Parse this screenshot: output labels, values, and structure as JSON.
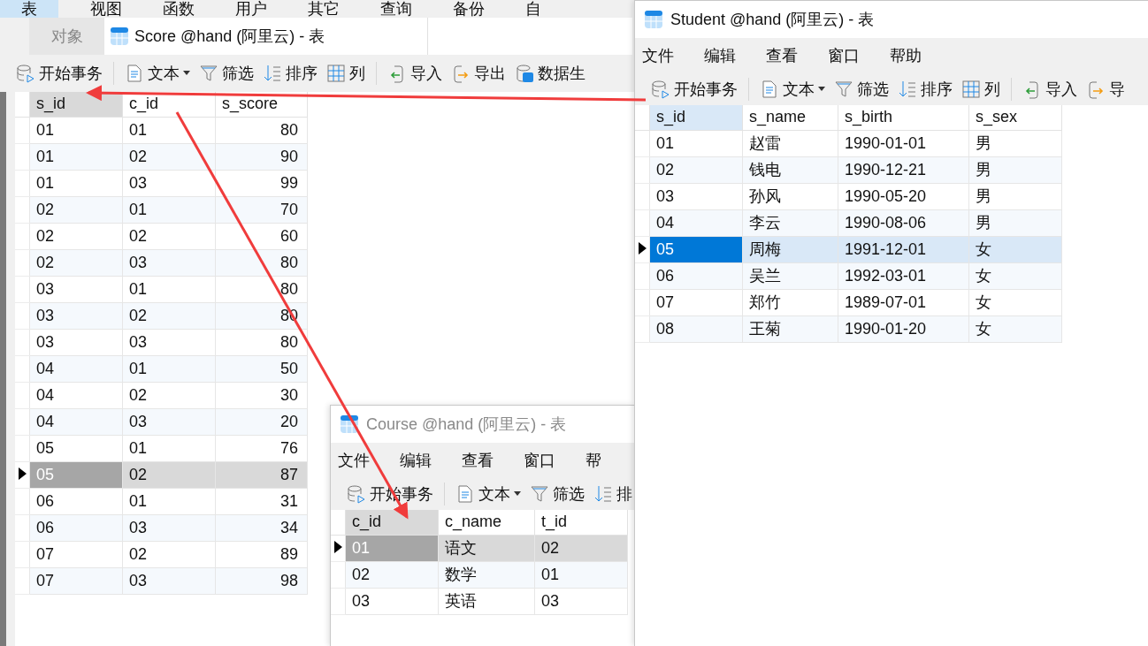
{
  "main_window": {
    "active": false,
    "menu": [
      {
        "label": "表",
        "selected": true
      },
      {
        "label": "视图",
        "selected": false
      },
      {
        "label": "函数",
        "selected": false
      },
      {
        "label": "用户",
        "selected": false
      },
      {
        "label": "其它",
        "selected": false
      },
      {
        "label": "查询",
        "selected": false
      },
      {
        "label": "备份",
        "selected": false
      },
      {
        "label": "自",
        "selected": false
      }
    ],
    "tabs": [
      {
        "label": "对象",
        "selected": false
      },
      {
        "label": "Score @hand (阿里云) - 表",
        "selected": true
      }
    ],
    "toolbar": [
      [
        {
          "kind": "transaction",
          "label": "开始事务"
        }
      ],
      [
        {
          "kind": "text",
          "label": "文本"
        },
        {
          "kind": "filter",
          "label": "筛选"
        },
        {
          "kind": "sort",
          "label": "排序"
        },
        {
          "kind": "columns",
          "label": "列"
        }
      ],
      [
        {
          "kind": "import",
          "label": "导入"
        },
        {
          "kind": "export",
          "label": "导出"
        },
        {
          "kind": "generate",
          "label": "数据生"
        }
      ]
    ],
    "table": {
      "columns": [
        {
          "label": "s_id",
          "selected": true,
          "kind": "text"
        },
        {
          "label": "c_id",
          "selected": false,
          "kind": "text"
        },
        {
          "label": "s_score",
          "selected": false,
          "kind": "number"
        }
      ],
      "rows": [
        {
          "cells": [
            "01",
            "01",
            "80"
          ],
          "selected": false
        },
        {
          "cells": [
            "01",
            "02",
            "90"
          ],
          "selected": false
        },
        {
          "cells": [
            "01",
            "03",
            "99"
          ],
          "selected": false
        },
        {
          "cells": [
            "02",
            "01",
            "70"
          ],
          "selected": false
        },
        {
          "cells": [
            "02",
            "02",
            "60"
          ],
          "selected": false
        },
        {
          "cells": [
            "02",
            "03",
            "80"
          ],
          "selected": false
        },
        {
          "cells": [
            "03",
            "01",
            "80"
          ],
          "selected": false
        },
        {
          "cells": [
            "03",
            "02",
            "80"
          ],
          "selected": false
        },
        {
          "cells": [
            "03",
            "03",
            "80"
          ],
          "selected": false
        },
        {
          "cells": [
            "04",
            "01",
            "50"
          ],
          "selected": false
        },
        {
          "cells": [
            "04",
            "02",
            "30"
          ],
          "selected": false
        },
        {
          "cells": [
            "04",
            "03",
            "20"
          ],
          "selected": false
        },
        {
          "cells": [
            "05",
            "01",
            "76"
          ],
          "selected": false
        },
        {
          "cells": [
            "05",
            "02",
            "87"
          ],
          "selected": true
        },
        {
          "cells": [
            "06",
            "01",
            "31"
          ],
          "selected": false
        },
        {
          "cells": [
            "06",
            "03",
            "34"
          ],
          "selected": false
        },
        {
          "cells": [
            "07",
            "02",
            "89"
          ],
          "selected": false
        },
        {
          "cells": [
            "07",
            "03",
            "98"
          ],
          "selected": false
        }
      ]
    }
  },
  "student_window": {
    "title": "Student @hand (阿里云) - 表",
    "active": true,
    "menu": [
      "文件",
      "编辑",
      "查看",
      "窗口",
      "帮助"
    ],
    "toolbar": [
      [
        {
          "kind": "transaction",
          "label": "开始事务"
        }
      ],
      [
        {
          "kind": "text",
          "label": "文本"
        },
        {
          "kind": "filter",
          "label": "筛选"
        },
        {
          "kind": "sort",
          "label": "排序"
        },
        {
          "kind": "columns",
          "label": "列"
        }
      ],
      [
        {
          "kind": "import",
          "label": "导入"
        },
        {
          "kind": "export",
          "label": "导"
        }
      ]
    ],
    "table": {
      "columns": [
        {
          "label": "s_id",
          "selected": true,
          "kind": "text"
        },
        {
          "label": "s_name",
          "selected": false,
          "kind": "text"
        },
        {
          "label": "s_birth",
          "selected": false,
          "kind": "text"
        },
        {
          "label": "s_sex",
          "selected": false,
          "kind": "text"
        }
      ],
      "rows": [
        {
          "cells": [
            "01",
            "赵雷",
            "1990-01-01",
            "男"
          ],
          "selected": false
        },
        {
          "cells": [
            "02",
            "钱电",
            "1990-12-21",
            "男"
          ],
          "selected": false
        },
        {
          "cells": [
            "03",
            "孙风",
            "1990-05-20",
            "男"
          ],
          "selected": false
        },
        {
          "cells": [
            "04",
            "李云",
            "1990-08-06",
            "男"
          ],
          "selected": false
        },
        {
          "cells": [
            "05",
            "周梅",
            "1991-12-01",
            "女"
          ],
          "selected": true
        },
        {
          "cells": [
            "06",
            "吴兰",
            "1992-03-01",
            "女"
          ],
          "selected": false
        },
        {
          "cells": [
            "07",
            "郑竹",
            "1989-07-01",
            "女"
          ],
          "selected": false
        },
        {
          "cells": [
            "08",
            "王菊",
            "1990-01-20",
            "女"
          ],
          "selected": false
        }
      ]
    }
  },
  "course_window": {
    "title": "Course @hand (阿里云) - 表",
    "active": false,
    "menu": [
      "文件",
      "编辑",
      "查看",
      "窗口",
      "帮"
    ],
    "toolbar": [
      [
        {
          "kind": "transaction",
          "label": "开始事务"
        }
      ],
      [
        {
          "kind": "text",
          "label": "文本"
        },
        {
          "kind": "filter",
          "label": "筛选"
        },
        {
          "kind": "sort",
          "label": "排"
        }
      ]
    ],
    "table": {
      "columns": [
        {
          "label": "c_id",
          "selected": true,
          "kind": "text"
        },
        {
          "label": "c_name",
          "selected": false,
          "kind": "text"
        },
        {
          "label": "t_id",
          "selected": false,
          "kind": "text"
        }
      ],
      "rows": [
        {
          "cells": [
            "01",
            "语文",
            "02"
          ],
          "selected": true
        },
        {
          "cells": [
            "02",
            "数学",
            "01"
          ],
          "selected": false
        },
        {
          "cells": [
            "03",
            "英语",
            "03"
          ],
          "selected": false
        }
      ]
    }
  }
}
